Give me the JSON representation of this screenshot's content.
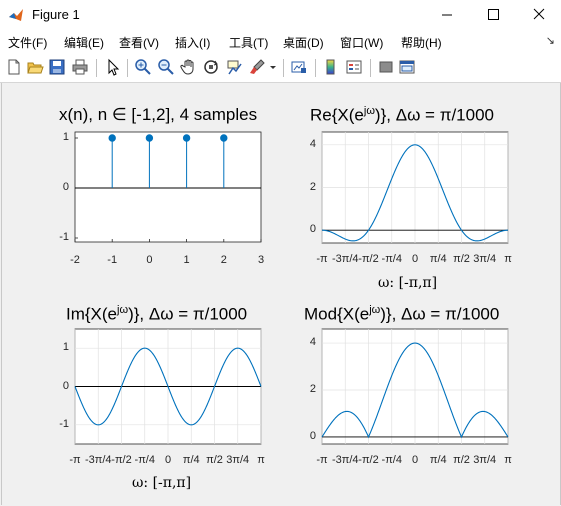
{
  "window": {
    "title": "Figure 1",
    "minimize_icon": "minimize-icon",
    "maximize_icon": "maximize-icon",
    "close_icon": "close-icon"
  },
  "menu": {
    "items": [
      "文件(F)",
      "编辑(E)",
      "查看(V)",
      "插入(I)",
      "工具(T)",
      "桌面(D)",
      "窗口(W)",
      "帮助(H)"
    ],
    "overflow": "↘"
  },
  "toolbar": {
    "icons": [
      "new-figure-icon",
      "open-file-icon",
      "save-icon",
      "print-icon",
      "pointer-icon",
      "zoom-in-icon",
      "zoom-out-icon",
      "pan-icon",
      "rotate-3d-icon",
      "data-cursor-icon",
      "brush-icon",
      "link-plot-icon",
      "colorbar-icon",
      "legend-icon",
      "hide-plot-tools-icon",
      "show-plot-tools-icon"
    ]
  },
  "axes": {
    "tl": {
      "title": "x(n), n ∈ [-1,2], 4 samples",
      "xticks": [
        "-2",
        "-1",
        "0",
        "1",
        "2",
        "3"
      ],
      "yticks": [
        "1",
        "0",
        "-1"
      ]
    },
    "tr": {
      "title_pre": "Re{X(e",
      "title_sup": "jω",
      "title_post": ")}, Δω = π/1000",
      "xticks": [
        "-π",
        "-3π/4",
        "-π/2",
        "-π/4",
        "0",
        "π/4",
        "π/2",
        "3π/4",
        "π"
      ],
      "yticks": [
        "4",
        "2",
        "0"
      ],
      "xlabel": "ω: [-π,π]"
    },
    "bl": {
      "title_pre": "Im{X(e",
      "title_sup": "jω",
      "title_post": ")}, Δω = π/1000",
      "xticks": [
        "-π",
        "-3π/4",
        "-π/2",
        "-π/4",
        "0",
        "π/4",
        "π/2",
        "3π/4",
        "π"
      ],
      "yticks": [
        "1",
        "0",
        "-1"
      ],
      "xlabel": "ω: [-π,π]"
    },
    "br": {
      "title_pre": "Mod{X(e",
      "title_sup": "jω",
      "title_post": ")}, Δω = π/1000",
      "xticks": [
        "-π",
        "-3π/4",
        "-π/2",
        "-π/4",
        "0",
        "π/4",
        "π/2",
        "3π/4",
        "π"
      ],
      "yticks": [
        "4",
        "2",
        "0"
      ]
    }
  },
  "colors": {
    "line": "#0072bd",
    "axes_bg": "#ffffff",
    "grid": "#e1e1e1"
  },
  "chart_data": [
    {
      "type": "scatter",
      "title": "x(n), n ∈ [-1,2], 4 samples",
      "style": "stem",
      "x": [
        -1,
        0,
        1,
        2
      ],
      "y": [
        1,
        1,
        1,
        1
      ],
      "xlim": [
        -2,
        3
      ],
      "ylim": [
        -1,
        1
      ]
    },
    {
      "type": "line",
      "title": "Re{X(e^jω)}, Δω = π/1000",
      "function": "sum_{n=-1..2} cos(ω·n)",
      "xlim": [
        -3.1416,
        3.1416
      ],
      "ylim": [
        -0.6,
        4.6
      ],
      "grid": true
    },
    {
      "type": "line",
      "title": "Im{X(e^jω)}, Δω = π/1000",
      "function": "-sum_{n=-1..2} sin(ω·n)",
      "xlim": [
        -3.1416,
        3.1416
      ],
      "ylim": [
        -1.5,
        1.5
      ],
      "grid": true
    },
    {
      "type": "line",
      "title": "Mod{X(e^jω)}, Δω = π/1000",
      "function": "|sum_{n=-1..2} e^{-jωn}|",
      "xlim": [
        -3.1416,
        3.1416
      ],
      "ylim": [
        -0.3,
        4.6
      ],
      "grid": true
    }
  ]
}
